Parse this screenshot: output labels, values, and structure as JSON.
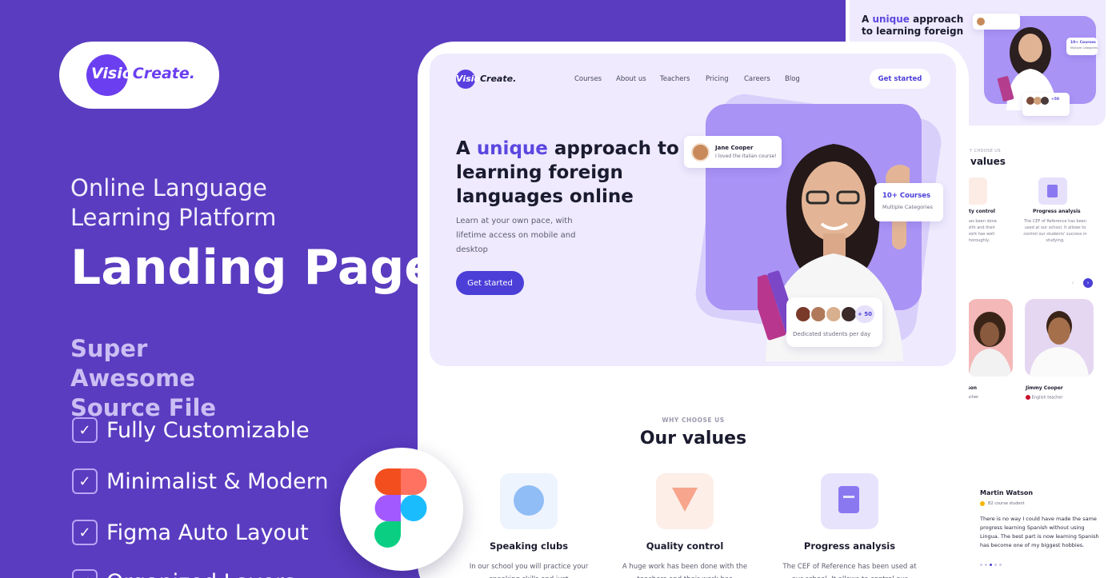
{
  "left": {
    "logo": {
      "part1": "Visio",
      "part2": "Create."
    },
    "subtitle": "Online Language Learning Platform",
    "title": "Landing Page",
    "tagline": "Super Awesome Source File",
    "features": [
      "Fully Customizable",
      "Minimalist & Modern",
      "Figma Auto Layout",
      "Organized Layers"
    ]
  },
  "site": {
    "logo": {
      "part1": "Visio",
      "part2": "Create."
    },
    "nav": [
      "Courses",
      "About us",
      "Teachers",
      "Pricing",
      "Careers",
      "Blog"
    ],
    "nav_cta": "Get started",
    "hero": {
      "title_pre": "A ",
      "title_accent": "unique",
      "title_post": " approach to learning foreign languages online",
      "paragraph": "Learn at your own pace, with lifetime access on mobile and desktop",
      "cta": "Get started"
    },
    "testimonial_chip": {
      "name": "Jane Cooper",
      "text": "I loved the Italian course!"
    },
    "courses_chip": {
      "title": "10+ Courses",
      "subtitle": "Multiple Categories"
    },
    "students_chip": {
      "count": "+ 50",
      "label": "Dedicated students per day"
    },
    "values": {
      "eyebrow": "WHY CHOOSE US",
      "heading": "Our values",
      "items": [
        {
          "title": "Speaking clubs",
          "desc": "In our school you will practice your speaking skills and just"
        },
        {
          "title": "Quality control",
          "desc": "A huge work has been done with the teachers and their work has"
        },
        {
          "title": "Progress analysis",
          "desc": "The CEF of Reference has been used at our school. It allows to control our"
        }
      ]
    }
  },
  "preview": {
    "hero_title_pre": "A ",
    "hero_title_accent": "unique",
    "hero_title_post": " approach to learning foreign",
    "chip_courses": "10+ Courses",
    "chip_courses_sub": "Multiple Categories",
    "chip_students": "+50",
    "eyebrow": "Y CHOOSE US",
    "values_heading": "values",
    "value_a_title": "ity control",
    "value_a_desc": "has been done with and their work has well thoroughly.",
    "value_b_title": "Progress analysis",
    "value_b_desc": "The CEF of Reference has been used at our school. It allows to control our students' success in studying.",
    "teacher_a_name": "son",
    "teacher_a_role": "acher",
    "teacher_b_name": "Jimmy Cooper",
    "teacher_b_role": "English teacher",
    "review": {
      "name": "Martin Watson",
      "role": "B2 course student",
      "quote": "There is no way I could have made the same progress learning Spanish without using Lingua. The best part is now learning Spanish has become one of my biggest hobbies."
    }
  },
  "colors": {
    "brand": "#5a3cc0",
    "accent": "#5b47e0",
    "hero_bg": "#efeafd"
  },
  "icons": [
    "check-icon",
    "figma-logo-icon",
    "play-icon",
    "funnel-icon",
    "document-icon",
    "chevron-left-icon",
    "chevron-right-icon"
  ]
}
